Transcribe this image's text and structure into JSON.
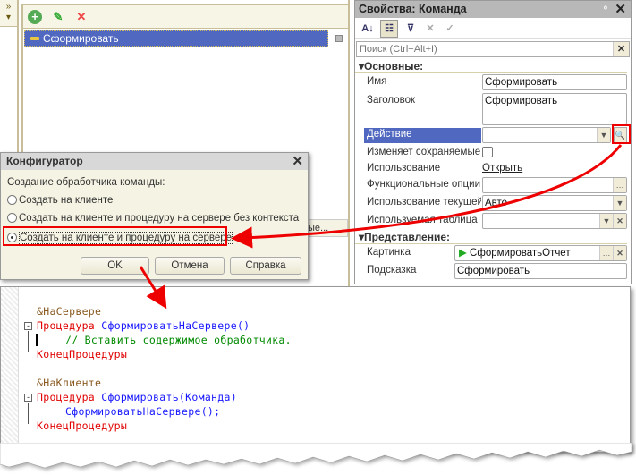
{
  "form": {
    "selected_item": "Сформировать",
    "toolbar": {
      "add": "add-icon",
      "edit": "pencil-icon",
      "delete": "delete-icon"
    },
    "partial_label": "ые..."
  },
  "props": {
    "title": "Свойства: Команда",
    "search_placeholder": "Поиск (Ctrl+Alt+I)",
    "sections": {
      "main": "Основные:",
      "view": "Представление:"
    },
    "rows": {
      "name": {
        "label": "Имя",
        "value": "Сформировать"
      },
      "header": {
        "label": "Заголовок",
        "value": "Сформировать"
      },
      "action": {
        "label": "Действие",
        "value": ""
      },
      "modifies": {
        "label": "Изменяет сохраняемые данные"
      },
      "usage": {
        "label": "Использование",
        "value": "Открыть"
      },
      "funcopts": {
        "label": "Функциональные опции",
        "value": ""
      },
      "curusage": {
        "label": "Использование текущей строки",
        "value": "Авто"
      },
      "table": {
        "label": "Используемая таблица",
        "value": ""
      },
      "picture": {
        "label": "Картинка",
        "value": "СформироватьОтчет"
      },
      "tooltip": {
        "label": "Подсказка",
        "value": "Сформировать"
      }
    }
  },
  "dialog": {
    "title": "Конфигуратор",
    "prompt": "Создание обработчика команды:",
    "options": [
      "Создать на клиенте",
      "Создать на клиенте и процедуру на сервере без контекста",
      "Создать на клиенте и процедуру на сервере"
    ],
    "selected_index": 2,
    "buttons": {
      "ok": "OK",
      "cancel": "Отмена",
      "help": "Справка"
    }
  },
  "code": {
    "l1": "&НаСервере",
    "l2a": "Процедура",
    "l2b": "СформироватьНаСервере()",
    "l3": "// Вставить содержимое обработчика.",
    "l4": "КонецПроцедуры",
    "l5": "&НаКлиенте",
    "l6a": "Процедура",
    "l6b": "Сформировать(Команда)",
    "l7": "СформироватьНаСервере();",
    "l8": "КонецПроцедуры"
  },
  "colors": {
    "accent": "#e00000",
    "selection": "#5068c0"
  }
}
